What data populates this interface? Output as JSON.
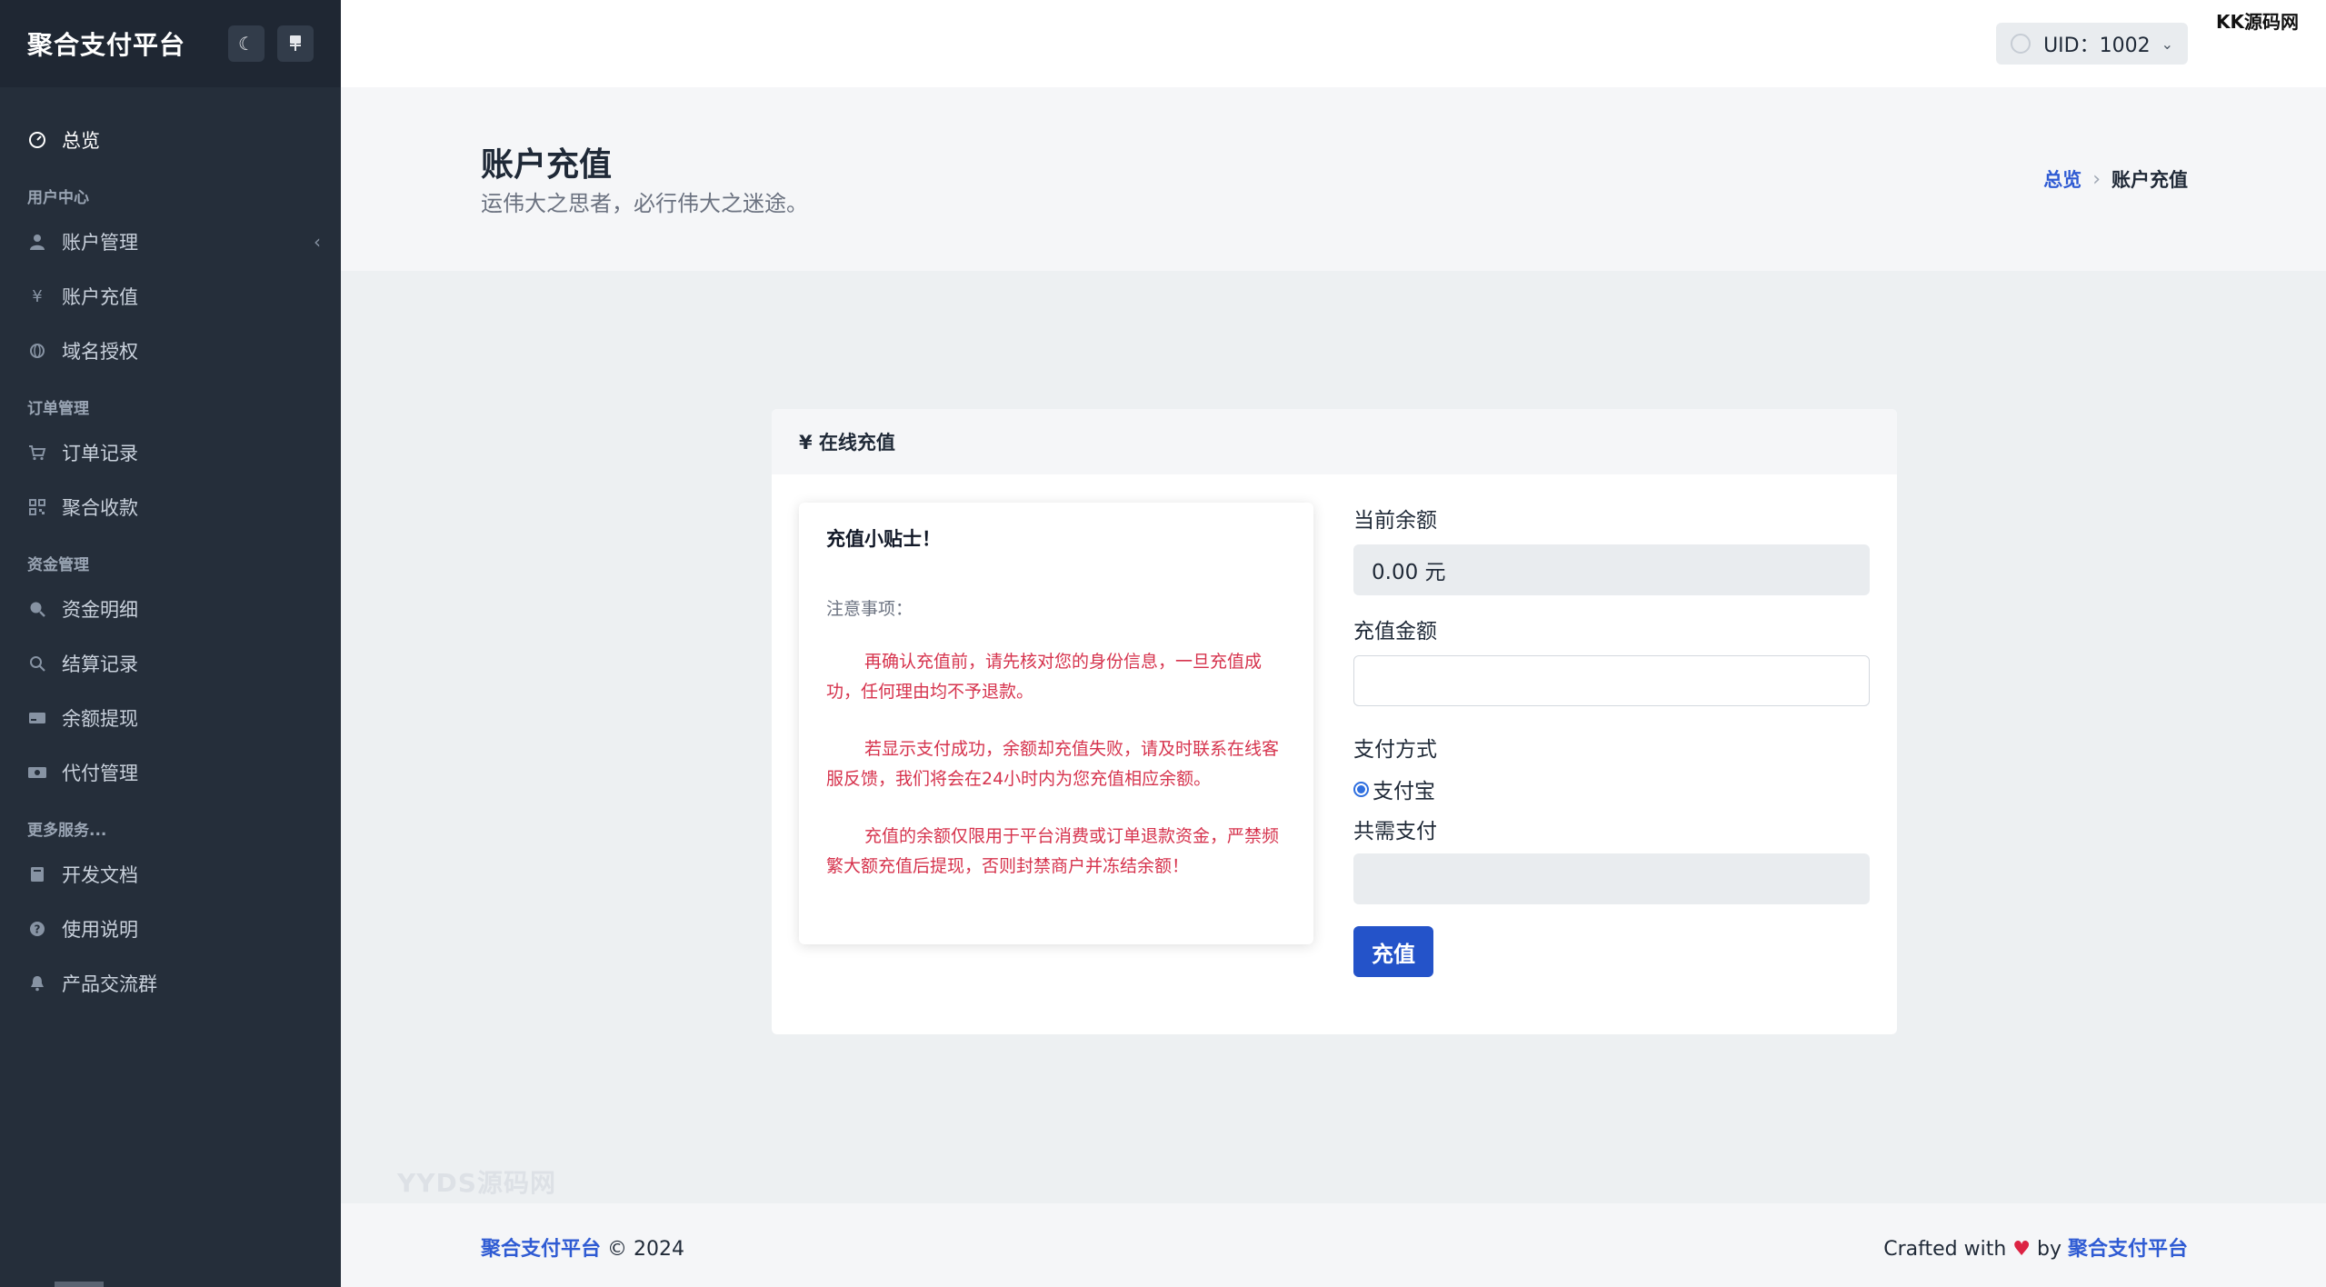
{
  "sidebar": {
    "brand": "聚合支付平台",
    "theme_icon": "moon-icon",
    "layout_icon": "layout-icon",
    "overview": {
      "label": "总览",
      "icon": "dashboard-icon"
    },
    "sections": [
      {
        "heading": "用户中心"
      },
      {
        "heading": "订单管理"
      },
      {
        "heading": "资金管理"
      },
      {
        "heading": "更多服务..."
      }
    ],
    "items": [
      {
        "label": "账户管理",
        "icon": "user-icon"
      },
      {
        "label": "账户充值",
        "icon": "yen-icon"
      },
      {
        "label": "域名授权",
        "icon": "globe-icon"
      },
      {
        "label": "订单记录",
        "icon": "cart-icon"
      },
      {
        "label": "聚合收款",
        "icon": "qrcode-icon"
      },
      {
        "label": "资金明细",
        "icon": "search-dollar-icon"
      },
      {
        "label": "结算记录",
        "icon": "search-icon"
      },
      {
        "label": "余额提现",
        "icon": "card-icon"
      },
      {
        "label": "代付管理",
        "icon": "money-icon"
      },
      {
        "label": "开发文档",
        "icon": "book-icon"
      },
      {
        "label": "使用说明",
        "icon": "help-icon"
      },
      {
        "label": "产品交流群",
        "icon": "bell-icon"
      }
    ]
  },
  "topbar": {
    "uid_label": "UID：1002",
    "watermark": "KK源码网"
  },
  "hero": {
    "title": "账户充值",
    "subtitle": "运伟大之思者，必行伟大之迷途。",
    "breadcrumb": {
      "home": "总览",
      "current": "账户充值"
    }
  },
  "card": {
    "title": "¥ 在线充值",
    "tips": {
      "title": "充值小贴士！",
      "note": "注意事项：",
      "paragraphs": [
        "再确认充值前，请先核对您的身份信息，一旦充值成功，任何理由均不予退款。",
        "若显示支付成功，余额却充值失败，请及时联系在线客服反馈，我们将会在24小时内为您充值相应余额。",
        "充值的余额仅限用于平台消费或订单退款资金，严禁频繁大额充值后提现，否则封禁商户并冻结余额！"
      ]
    },
    "form": {
      "balance_label": "当前余额",
      "balance_value": "0.00 元",
      "amount_label": "充值金额",
      "amount_value": "",
      "method_label": "支付方式",
      "method_option": "支付宝",
      "total_label": "共需支付",
      "total_value": "",
      "submit_label": "充值"
    }
  },
  "watermark_bottom": "YYDS源码网",
  "footer": {
    "brand": "聚合支付平台",
    "copyright": " © 2024",
    "crafted": "Crafted with ",
    "by": " by ",
    "brand_right": "聚合支付平台"
  },
  "colors": {
    "sidebar_bg": "#252e3a",
    "accent": "#2453c9",
    "link": "#2f5bd3",
    "warning_text": "#d6334d"
  }
}
